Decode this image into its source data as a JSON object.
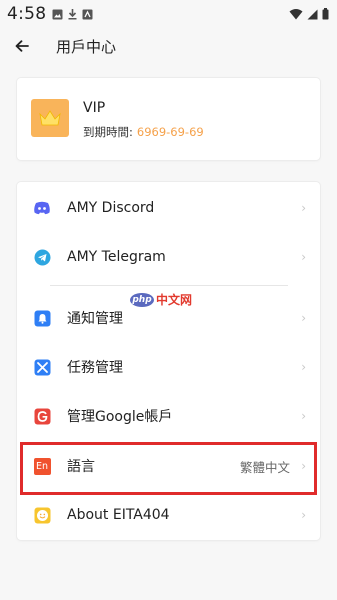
{
  "status_bar": {
    "time": "4:58"
  },
  "header": {
    "title": "用戶中心"
  },
  "vip": {
    "name": "VIP",
    "expiry_label": "到期時間:",
    "expiry_date": "6969-69-69"
  },
  "menu": {
    "items": [
      {
        "label": "AMY Discord",
        "icon": "discord-icon"
      },
      {
        "label": "AMY Telegram",
        "icon": "telegram-icon"
      },
      {
        "label": "通知管理",
        "icon": "bell-icon"
      },
      {
        "label": "任務管理",
        "icon": "tools-icon"
      },
      {
        "label": "管理Google帳戶",
        "icon": "google-icon"
      },
      {
        "label": "語言",
        "icon": "language-icon",
        "value": "繁體中文",
        "icon_text": "En"
      },
      {
        "label": "About EITA404",
        "icon": "smiley-icon"
      }
    ]
  },
  "watermark": {
    "logo": "php",
    "text": "中文网"
  },
  "colors": {
    "accent_orange": "#f9b45a",
    "date_orange": "#f5a14a",
    "highlight_red": "#e02b2b",
    "discord": "#5865f2",
    "telegram": "#2ea6e0",
    "notify_blue": "#2f7ff5",
    "tools_blue": "#2f7ff5",
    "google_red": "#e8453c",
    "language_red": "#f0522e",
    "smiley_yellow": "#f7c52e"
  }
}
